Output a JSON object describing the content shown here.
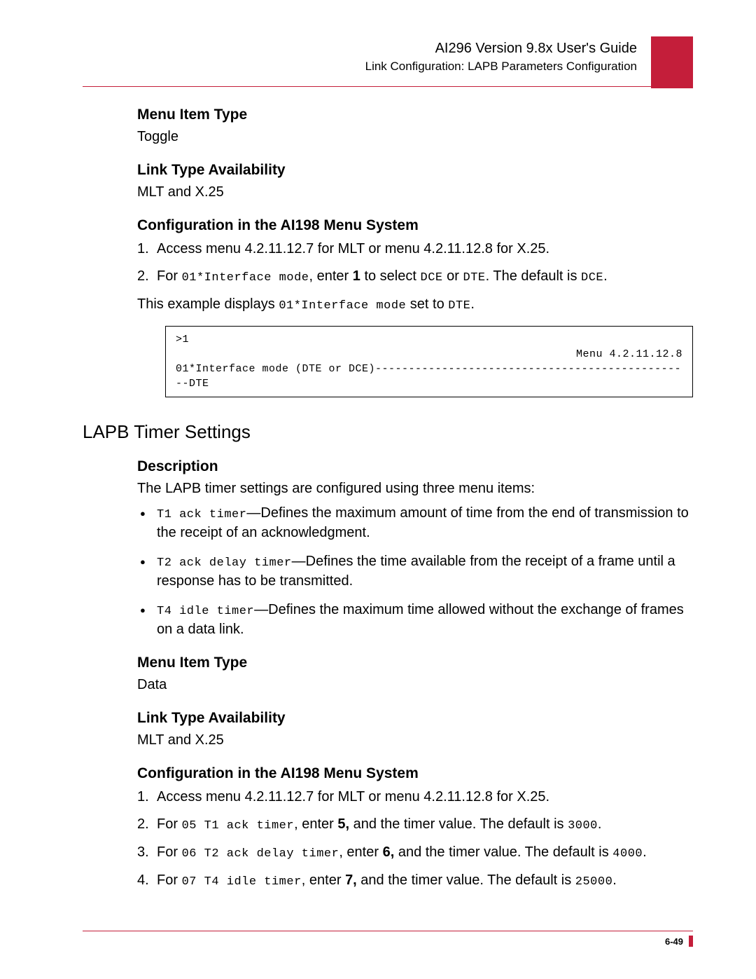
{
  "header": {
    "title": "AI296 Version 9.8x User's Guide",
    "subtitle": "Link Configuration: LAPB Parameters Configuration"
  },
  "s1": {
    "h_menu_type": "Menu Item Type",
    "menu_type_val": "Toggle",
    "h_link_avail": "Link Type Availability",
    "link_avail_val": "MLT and X.25",
    "h_config": "Configuration in the AI198 Menu System",
    "step1": "Access menu 4.2.11.12.7 for MLT or menu 4.2.11.12.8 for X.25.",
    "step2_a": "For ",
    "step2_code1": "01*Interface mode",
    "step2_b": ", enter ",
    "step2_bold": "1",
    "step2_c": " to select ",
    "step2_code2": "DCE",
    "step2_d": " or ",
    "step2_code3": "DTE",
    "step2_e": ". The default is ",
    "step2_code4": "DCE",
    "step2_f": ".",
    "example_intro_a": "This example displays ",
    "example_intro_code1": "01*Interface mode",
    "example_intro_b": " set to ",
    "example_intro_code2": "DTE",
    "example_intro_c": ".",
    "box_l1": ">1",
    "box_l2": "Menu 4.2.11.12.8",
    "box_l3": "01*Interface mode (DTE or DCE)------------------------------------------------DTE"
  },
  "s2": {
    "title": "LAPB Timer Settings",
    "h_desc": "Description",
    "desc_intro": "The LAPB timer settings are configured using three menu items:",
    "b1_code": "T1 ack timer",
    "b1_text": "—Defines the maximum amount of time from the end of transmission to the receipt of an acknowledgment.",
    "b2_code": "T2 ack delay timer",
    "b2_text": "—Defines the time available from the receipt of a frame until a response has to be transmitted.",
    "b3_code": "T4 idle timer",
    "b3_text": "—Defines the maximum time allowed without the exchange of frames on a data link.",
    "h_menu_type": "Menu Item Type",
    "menu_type_val": "Data",
    "h_link_avail": "Link Type Availability",
    "link_avail_val": "MLT and X.25",
    "h_config": "Configuration in the AI198 Menu System",
    "step1": "Access menu 4.2.11.12.7 for MLT or menu 4.2.11.12.8 for X.25.",
    "st2_a": "For ",
    "st2_code": "05 T1 ack timer",
    "st2_b": ", enter ",
    "st2_bold": "5,",
    "st2_c": "  and the timer value. The default is ",
    "st2_def": "3000",
    "st2_d": ".",
    "st3_a": "For ",
    "st3_code": "06 T2 ack delay timer",
    "st3_b": ", enter ",
    "st3_bold": "6,",
    "st3_c": "  and the timer value. The default is ",
    "st3_def": "4000",
    "st3_d": ".",
    "st4_a": "For ",
    "st4_code": "07 T4 idle timer",
    "st4_b": ", enter ",
    "st4_bold": "7,",
    "st4_c": "  and the timer value. The default is ",
    "st4_def": "25000",
    "st4_d": "."
  },
  "footer": {
    "page": "6-49"
  }
}
